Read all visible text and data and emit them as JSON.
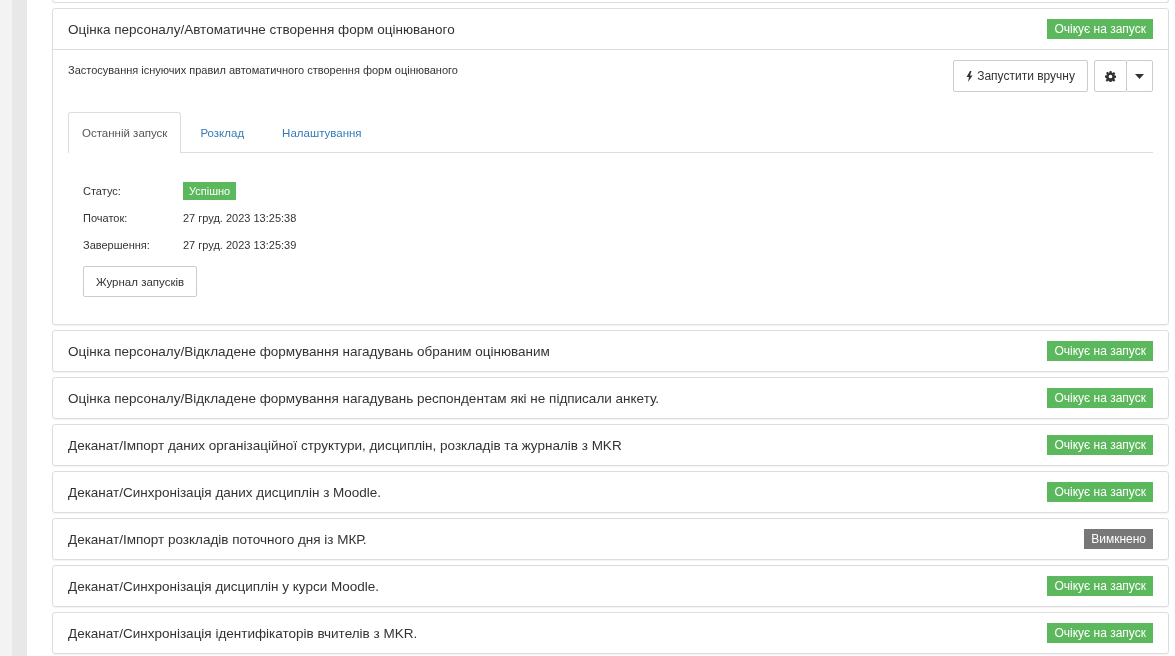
{
  "jobs": [
    {
      "title": "Оцінка персоналу/Автоматичне створення форм оцінюваного",
      "status": {
        "kind": "waiting",
        "label": "Очікує на запуск"
      },
      "expanded": true,
      "description": "Застосування існуючих правил автоматичного створення форм оцінюваного",
      "run_button": "Запустити вручну",
      "tabs": [
        {
          "label": "Останній запуск",
          "selected": true
        },
        {
          "label": "Розклад",
          "selected": false
        },
        {
          "label": "Налаштування",
          "selected": false
        }
      ],
      "last_run": {
        "fields": [
          {
            "label": "Статус:",
            "kind": "badge",
            "value": "Успішно"
          },
          {
            "label": "Початок:",
            "kind": "text",
            "value": "27 груд. 2023 13:25:38"
          },
          {
            "label": "Завершення:",
            "kind": "text",
            "value": "27 груд. 2023 13:25:39"
          }
        ],
        "log_button": "Журнал запусків"
      }
    },
    {
      "title": "Оцінка персоналу/Відкладене формування нагадувань обраним оцінюваним",
      "status": {
        "kind": "waiting",
        "label": "Очікує на запуск"
      },
      "expanded": false
    },
    {
      "title": "Оцінка персоналу/Відкладене формування нагадувань респондентам які не підписали анкету.",
      "status": {
        "kind": "waiting",
        "label": "Очікує на запуск"
      },
      "expanded": false
    },
    {
      "title": "Деканат/Імпорт даних організаційної структури, дисциплін, розкладів та журналів з MKR",
      "status": {
        "kind": "waiting",
        "label": "Очікує на запуск"
      },
      "expanded": false
    },
    {
      "title": "Деканат/Синхронізація даних дисциплін з Moodle.",
      "status": {
        "kind": "waiting",
        "label": "Очікує на запуск"
      },
      "expanded": false
    },
    {
      "title": "Деканат/Імпорт розкладів поточного дня із МКР.",
      "status": {
        "kind": "disabled",
        "label": "Вимкнено"
      },
      "expanded": false
    },
    {
      "title": "Деканат/Синхронізація дисциплін у курси Moodle.",
      "status": {
        "kind": "waiting",
        "label": "Очікує на запуск"
      },
      "expanded": false
    },
    {
      "title": "Деканат/Синхронізація ідентифікаторів вчителів з MKR.",
      "status": {
        "kind": "waiting",
        "label": "Очікує на запуск"
      },
      "expanded": false
    }
  ]
}
